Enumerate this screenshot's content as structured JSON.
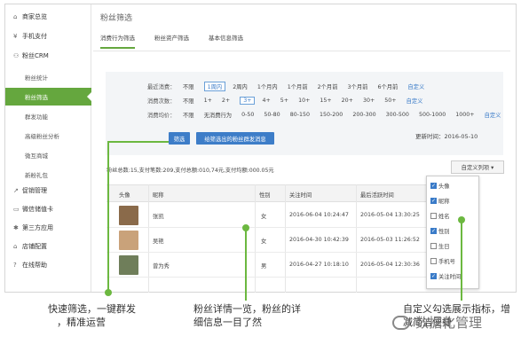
{
  "sidebar": {
    "items": [
      {
        "icon": "home-icon",
        "glyph": "⌂",
        "label": "商家总览"
      },
      {
        "icon": "yen-icon",
        "glyph": "¥",
        "label": "手机支付"
      },
      {
        "icon": "crm-icon",
        "glyph": "⚇",
        "label": "粉丝CRM"
      }
    ],
    "sub": [
      "粉丝统计",
      "粉丝筛选",
      "群发功能",
      "高级粉丝分析",
      "微互商城",
      "新粉礼包"
    ],
    "items2": [
      {
        "icon": "chart-icon",
        "glyph": "↗",
        "label": "促销管理"
      },
      {
        "icon": "card-icon",
        "glyph": "▭",
        "label": "微信储值卡"
      },
      {
        "icon": "apps-icon",
        "glyph": "✱",
        "label": "第三方应用"
      },
      {
        "icon": "store-icon",
        "glyph": "⌂",
        "label": "店铺配置"
      },
      {
        "icon": "help-icon",
        "glyph": "?",
        "label": "在线帮助"
      }
    ]
  },
  "page": {
    "title": "粉丝筛选",
    "tabs": [
      "消费行为筛选",
      "粉丝资产筛选",
      "基本信息筛选"
    ]
  },
  "filters": {
    "recent": {
      "label": "最近消费：",
      "options": [
        "不限",
        "1周内",
        "2周内",
        "1个月内",
        "1个月前",
        "2个月前",
        "3个月前",
        "6个月前"
      ],
      "selected": 1,
      "custom": "自定义"
    },
    "count": {
      "label": "消费次数：",
      "options": [
        "不限",
        "1+",
        "2+",
        "3+",
        "4+",
        "5+",
        "10+",
        "15+",
        "20+",
        "30+",
        "50+"
      ],
      "selected": 3,
      "custom": "自定义"
    },
    "amount": {
      "label": "消费均价：",
      "options": [
        "不限",
        "无消费行为",
        "0-50",
        "50-80",
        "80-150",
        "150-200",
        "200-300",
        "300-500",
        "500-1000",
        "1000+"
      ],
      "custom": "自定义"
    }
  },
  "buttons": {
    "filter": "筛选",
    "send": "给筛选出的粉丝群发消息"
  },
  "update_time": "更新时间：2016-05-10",
  "stats": "粉丝总数:15,支付笔数:209,支付总额:010,74元,支付均额:000.05元",
  "column_button": "自定义列项 ▾",
  "table": {
    "headers": [
      "头像",
      "昵称",
      "性别",
      "关注时间",
      "最后活跃时间"
    ],
    "rows": [
      {
        "name": "张凯",
        "gender": "女",
        "follow": "2016-06-04 10:24:47",
        "last": "2016-05-04 13:30:25",
        "avatar": "#8a6a4a"
      },
      {
        "name": "吴艳",
        "gender": "女",
        "follow": "2016-04-30 10:42:39",
        "last": "2016-05-03 11:26:52",
        "avatar": "#c9a27a"
      },
      {
        "name": "曾为秀",
        "gender": "男",
        "follow": "2016-04-27 10:18:10",
        "last": "2016-05-04 12:30:36",
        "avatar": "#6f7e5a"
      }
    ]
  },
  "dropdown": [
    {
      "label": "头像",
      "checked": true
    },
    {
      "label": "昵称",
      "checked": true
    },
    {
      "label": "姓名",
      "checked": false
    },
    {
      "label": "性别",
      "checked": true
    },
    {
      "label": "生日",
      "checked": false
    },
    {
      "label": "手机号",
      "checked": false
    },
    {
      "label": "关注时间",
      "checked": true
    }
  ],
  "annotations": {
    "left": [
      "快速筛选，一键群发",
      "，精准运营"
    ],
    "middle": [
      "粉丝详情一览，粉丝的详",
      "细信息一目了然"
    ],
    "right": [
      "自定义勾选展示指标，增",
      "减简洁便捷"
    ]
  },
  "watermark": "数据化管理",
  "colors": {
    "accent": "#65a73e",
    "button": "#3d7dc8",
    "callout": "#6cb840"
  }
}
